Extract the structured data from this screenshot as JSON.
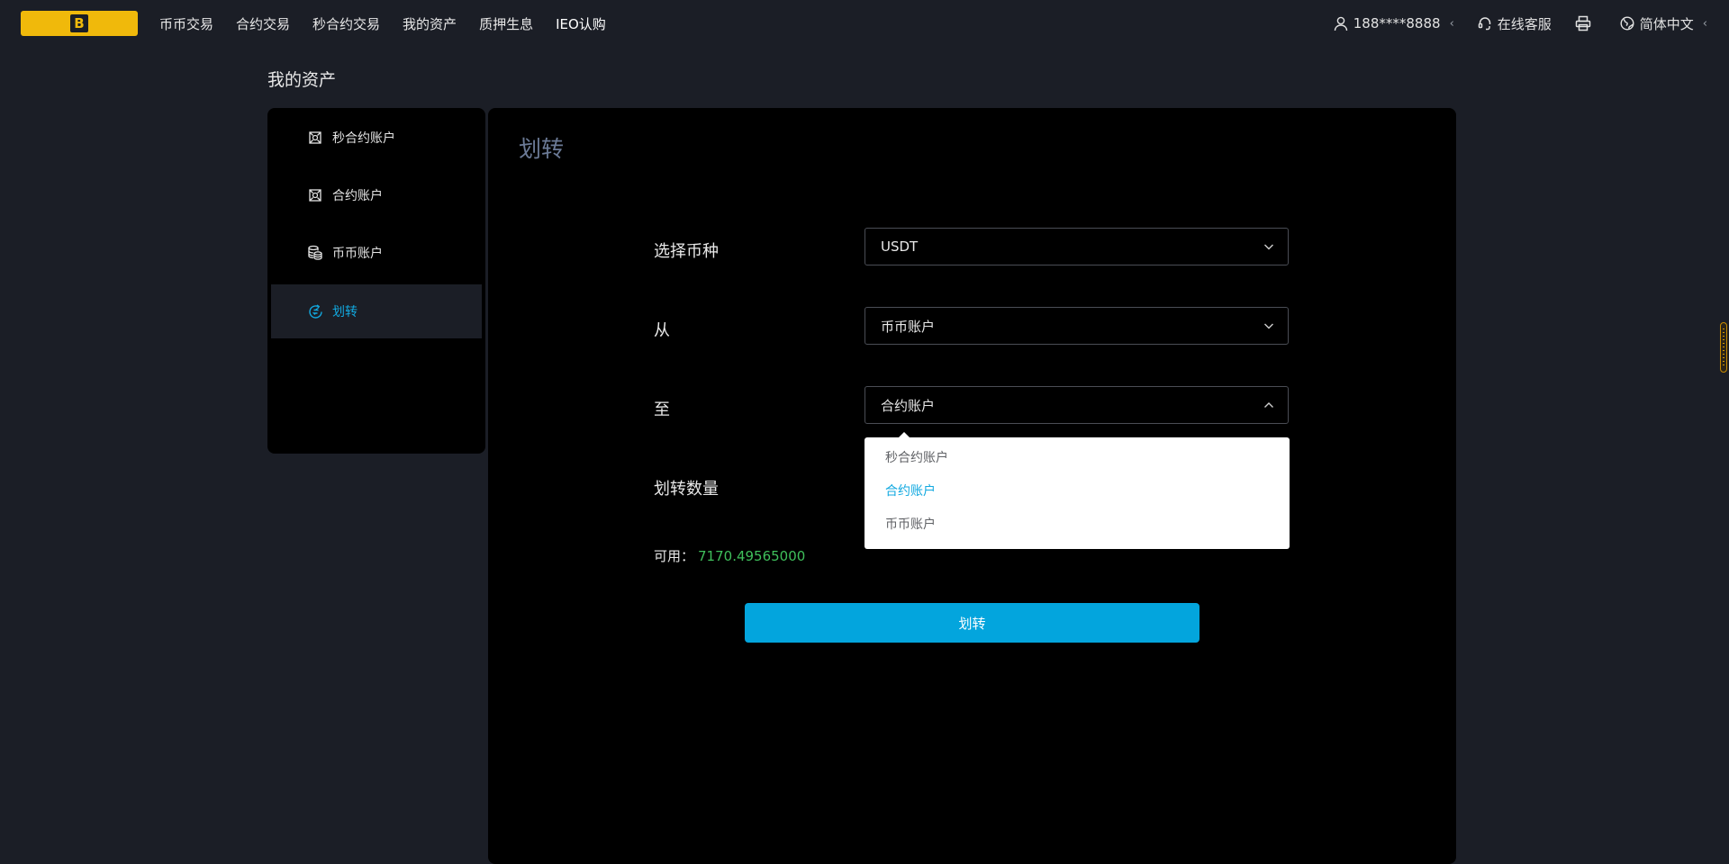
{
  "header": {
    "logo_glyph": "B",
    "nav": [
      "币币交易",
      "合约交易",
      "秒合约交易",
      "我的资产",
      "质押生息",
      "IEO认购"
    ],
    "user": {
      "phone": "188****8888",
      "caret": "‹",
      "icon": "user-icon"
    },
    "support": {
      "label": "在线客服",
      "icon": "headset-icon"
    },
    "print_icon": "printer-icon",
    "language": {
      "label": "简体中文",
      "caret": "‹",
      "icon": "globe-icon"
    }
  },
  "page": {
    "title": "我的资产"
  },
  "sidebar": {
    "items": [
      {
        "label": "秒合约账户",
        "icon": "grid-icon",
        "active": false
      },
      {
        "label": "合约账户",
        "icon": "grid-icon",
        "active": false
      },
      {
        "label": "币币账户",
        "icon": "coins-icon",
        "active": false
      },
      {
        "label": "划转",
        "icon": "transfer-icon",
        "active": true
      }
    ]
  },
  "transfer": {
    "title": "划转",
    "currency": {
      "label": "选择币种",
      "value": "USDT"
    },
    "from": {
      "label": "从",
      "value": "币币账户"
    },
    "to": {
      "label": "至",
      "value": "合约账户",
      "open": true
    },
    "amount": {
      "label": "划转数量"
    },
    "available": {
      "label": "可用：",
      "value": "7170.49565000"
    },
    "dropdown_options": [
      {
        "label": "秒合约账户",
        "selected": false
      },
      {
        "label": "合约账户",
        "selected": true
      },
      {
        "label": "币币账户",
        "selected": false
      }
    ],
    "submit_label": "划转"
  },
  "colors": {
    "background": "#1b1e26",
    "panel": "#000000",
    "accent": "#03a5dd",
    "logo": "#f0b90b",
    "available_value": "#3fbf5b"
  }
}
